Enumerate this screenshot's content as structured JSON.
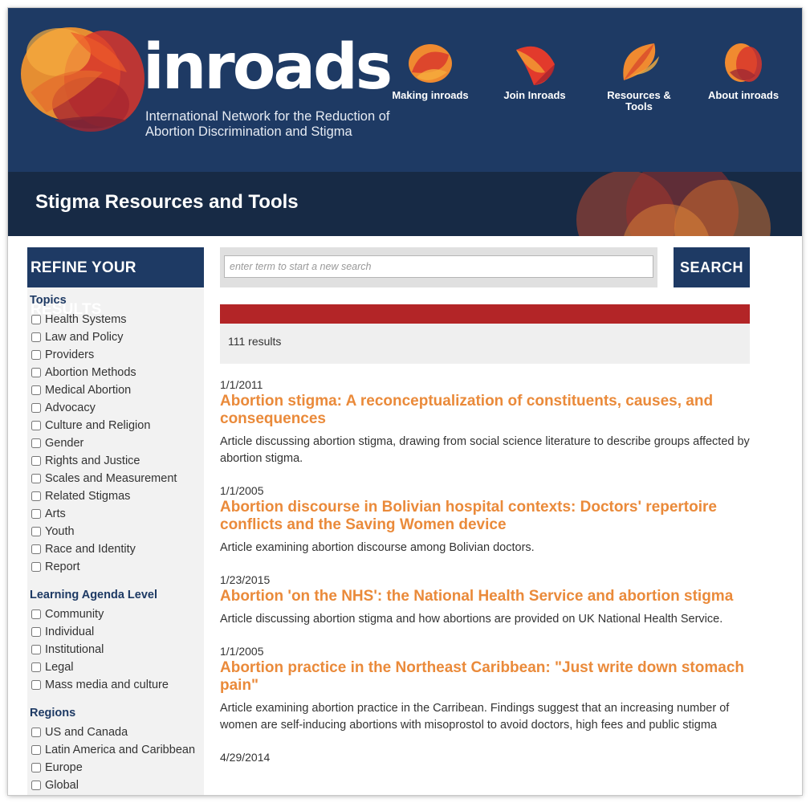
{
  "header": {
    "brand_name": "inroads",
    "tagline": "International Network for the Reduction of Abortion Discrimination and Stigma",
    "colors": {
      "navy": "#1e3a64",
      "orange": "#ea8a3a",
      "red": "#b32527"
    }
  },
  "nav": [
    {
      "label": "Making inroads",
      "icon": "making-inroads-icon"
    },
    {
      "label": "Join Inroads",
      "icon": "join-inroads-icon"
    },
    {
      "label": "Resources & Tools",
      "icon": "resources-tools-icon"
    },
    {
      "label": "About inroads",
      "icon": "about-inroads-icon"
    }
  ],
  "banner": {
    "title": "Stigma Resources and Tools"
  },
  "sidebar": {
    "heading": "REFINE YOUR RESULTS",
    "groups": [
      {
        "title": "Topics",
        "items": [
          "Health Systems",
          "Law and Policy",
          "Providers",
          "Abortion Methods",
          "Medical Abortion",
          "Advocacy",
          "Culture and Religion",
          "Gender",
          "Rights and Justice",
          "Scales and Measurement",
          "Related Stigmas",
          "Arts",
          "Youth",
          "Race and Identity",
          "Report"
        ]
      },
      {
        "title": "Learning Agenda Level",
        "items": [
          "Community",
          "Individual",
          "Institutional",
          "Legal",
          "Mass media and culture"
        ]
      },
      {
        "title": "Regions",
        "items": [
          "US and Canada",
          "Latin America and Caribbean",
          "Europe",
          "Global"
        ]
      }
    ]
  },
  "search": {
    "placeholder": "enter term to start a new search",
    "button_label": "SEARCH"
  },
  "results": {
    "count_text": "111 results",
    "items": [
      {
        "date": "1/1/2011",
        "title": "Abortion stigma: A reconceptualization of constituents, causes, and consequences",
        "description": "Article discussing abortion stigma, drawing from social science literature to describe groups affected by abortion stigma."
      },
      {
        "date": "1/1/2005",
        "title": "Abortion discourse in Bolivian hospital contexts: Doctors' repertoire conflicts and the Saving Women device",
        "description": "Article examining abortion discourse among Bolivian doctors."
      },
      {
        "date": "1/23/2015",
        "title": "Abortion 'on the NHS': the National Health Service and abortion stigma",
        "description": "Article discussing abortion stigma and how abortions are provided on UK National Health Service."
      },
      {
        "date": "1/1/2005",
        "title": "Abortion practice in the Northeast Caribbean: \"Just write down stomach pain\"",
        "description": "Article examining abortion practice in the Carribean. Findings suggest that an increasing number of women are self-inducing abortions with misoprostol to avoid doctors, high fees and public stigma"
      },
      {
        "date": "4/29/2014",
        "title": "",
        "description": ""
      }
    ]
  }
}
